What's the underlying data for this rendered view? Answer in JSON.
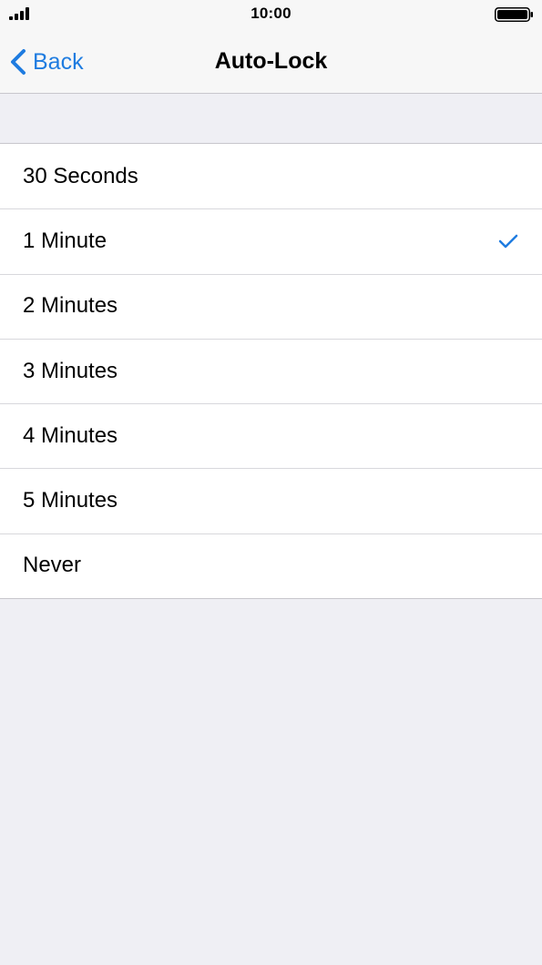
{
  "status_bar": {
    "time": "10:00",
    "signal_icon": "cellular-signal-icon",
    "battery_icon": "battery-icon"
  },
  "nav": {
    "back_label": "Back",
    "title": "Auto-Lock"
  },
  "options": [
    {
      "label": "30 Seconds",
      "selected": false
    },
    {
      "label": "1 Minute",
      "selected": true
    },
    {
      "label": "2 Minutes",
      "selected": false
    },
    {
      "label": "3 Minutes",
      "selected": false
    },
    {
      "label": "4 Minutes",
      "selected": false
    },
    {
      "label": "5 Minutes",
      "selected": false
    },
    {
      "label": "Never",
      "selected": false
    }
  ],
  "colors": {
    "accent": "#1f7ce0",
    "background": "#efeff4",
    "bar": "#f7f7f7",
    "separator": "#c8c7cc"
  }
}
